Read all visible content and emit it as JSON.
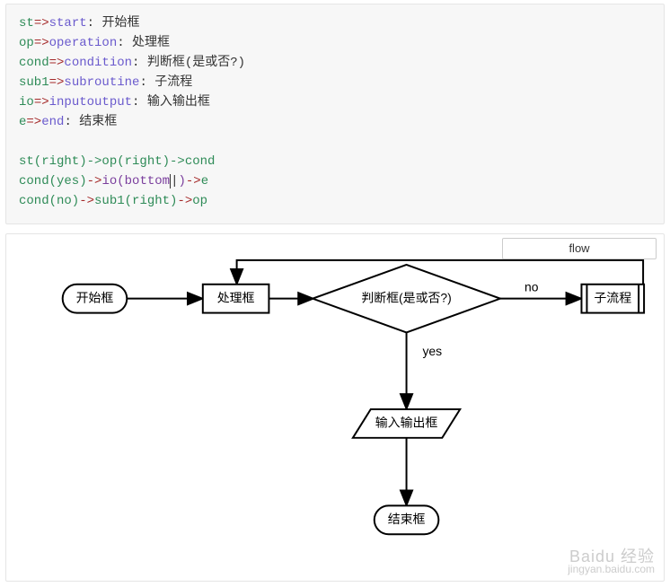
{
  "code": {
    "l1": {
      "id": "st",
      "arrow": "=>",
      "type": "start",
      "colon": ":",
      "text": " 开始框"
    },
    "l2": {
      "id": "op",
      "arrow": "=>",
      "type": "operation",
      "colon": ":",
      "text": " 处理框"
    },
    "l3": {
      "id": "cond",
      "arrow": "=>",
      "type": "condition",
      "colon": ":",
      "text": " 判断框(是或否?)"
    },
    "l4": {
      "id": "sub1",
      "arrow": "=>",
      "type": "subroutine",
      "colon": ":",
      "text": " 子流程"
    },
    "l5": {
      "id": "io",
      "arrow": "=>",
      "type": "inputoutput",
      "colon": ":",
      "text": " 输入输出框"
    },
    "l6": {
      "id": "e",
      "arrow": "=>",
      "type": "end",
      "colon": ":",
      "text": " 结束框"
    },
    "f1": "st(right)->op(right)->cond",
    "f2_a": "cond(yes)",
    "f2_b": "io(bottom",
    "f2_c": ")",
    "f2_d": "e",
    "f3_a": "cond(no)",
    "f3_b": "sub1(right)",
    "f3_c": "op",
    "arrow2": "->"
  },
  "button": {
    "label": "flow"
  },
  "nodes": {
    "start": "开始框",
    "operation": "处理框",
    "condition": "判断框(是或否?)",
    "subroutine": "子流程",
    "io": "输入输出框",
    "end": "结束框"
  },
  "edges": {
    "yes": "yes",
    "no": "no"
  },
  "watermark": {
    "line1": "Baidu 经验",
    "line2": "jingyan.baidu.com"
  }
}
